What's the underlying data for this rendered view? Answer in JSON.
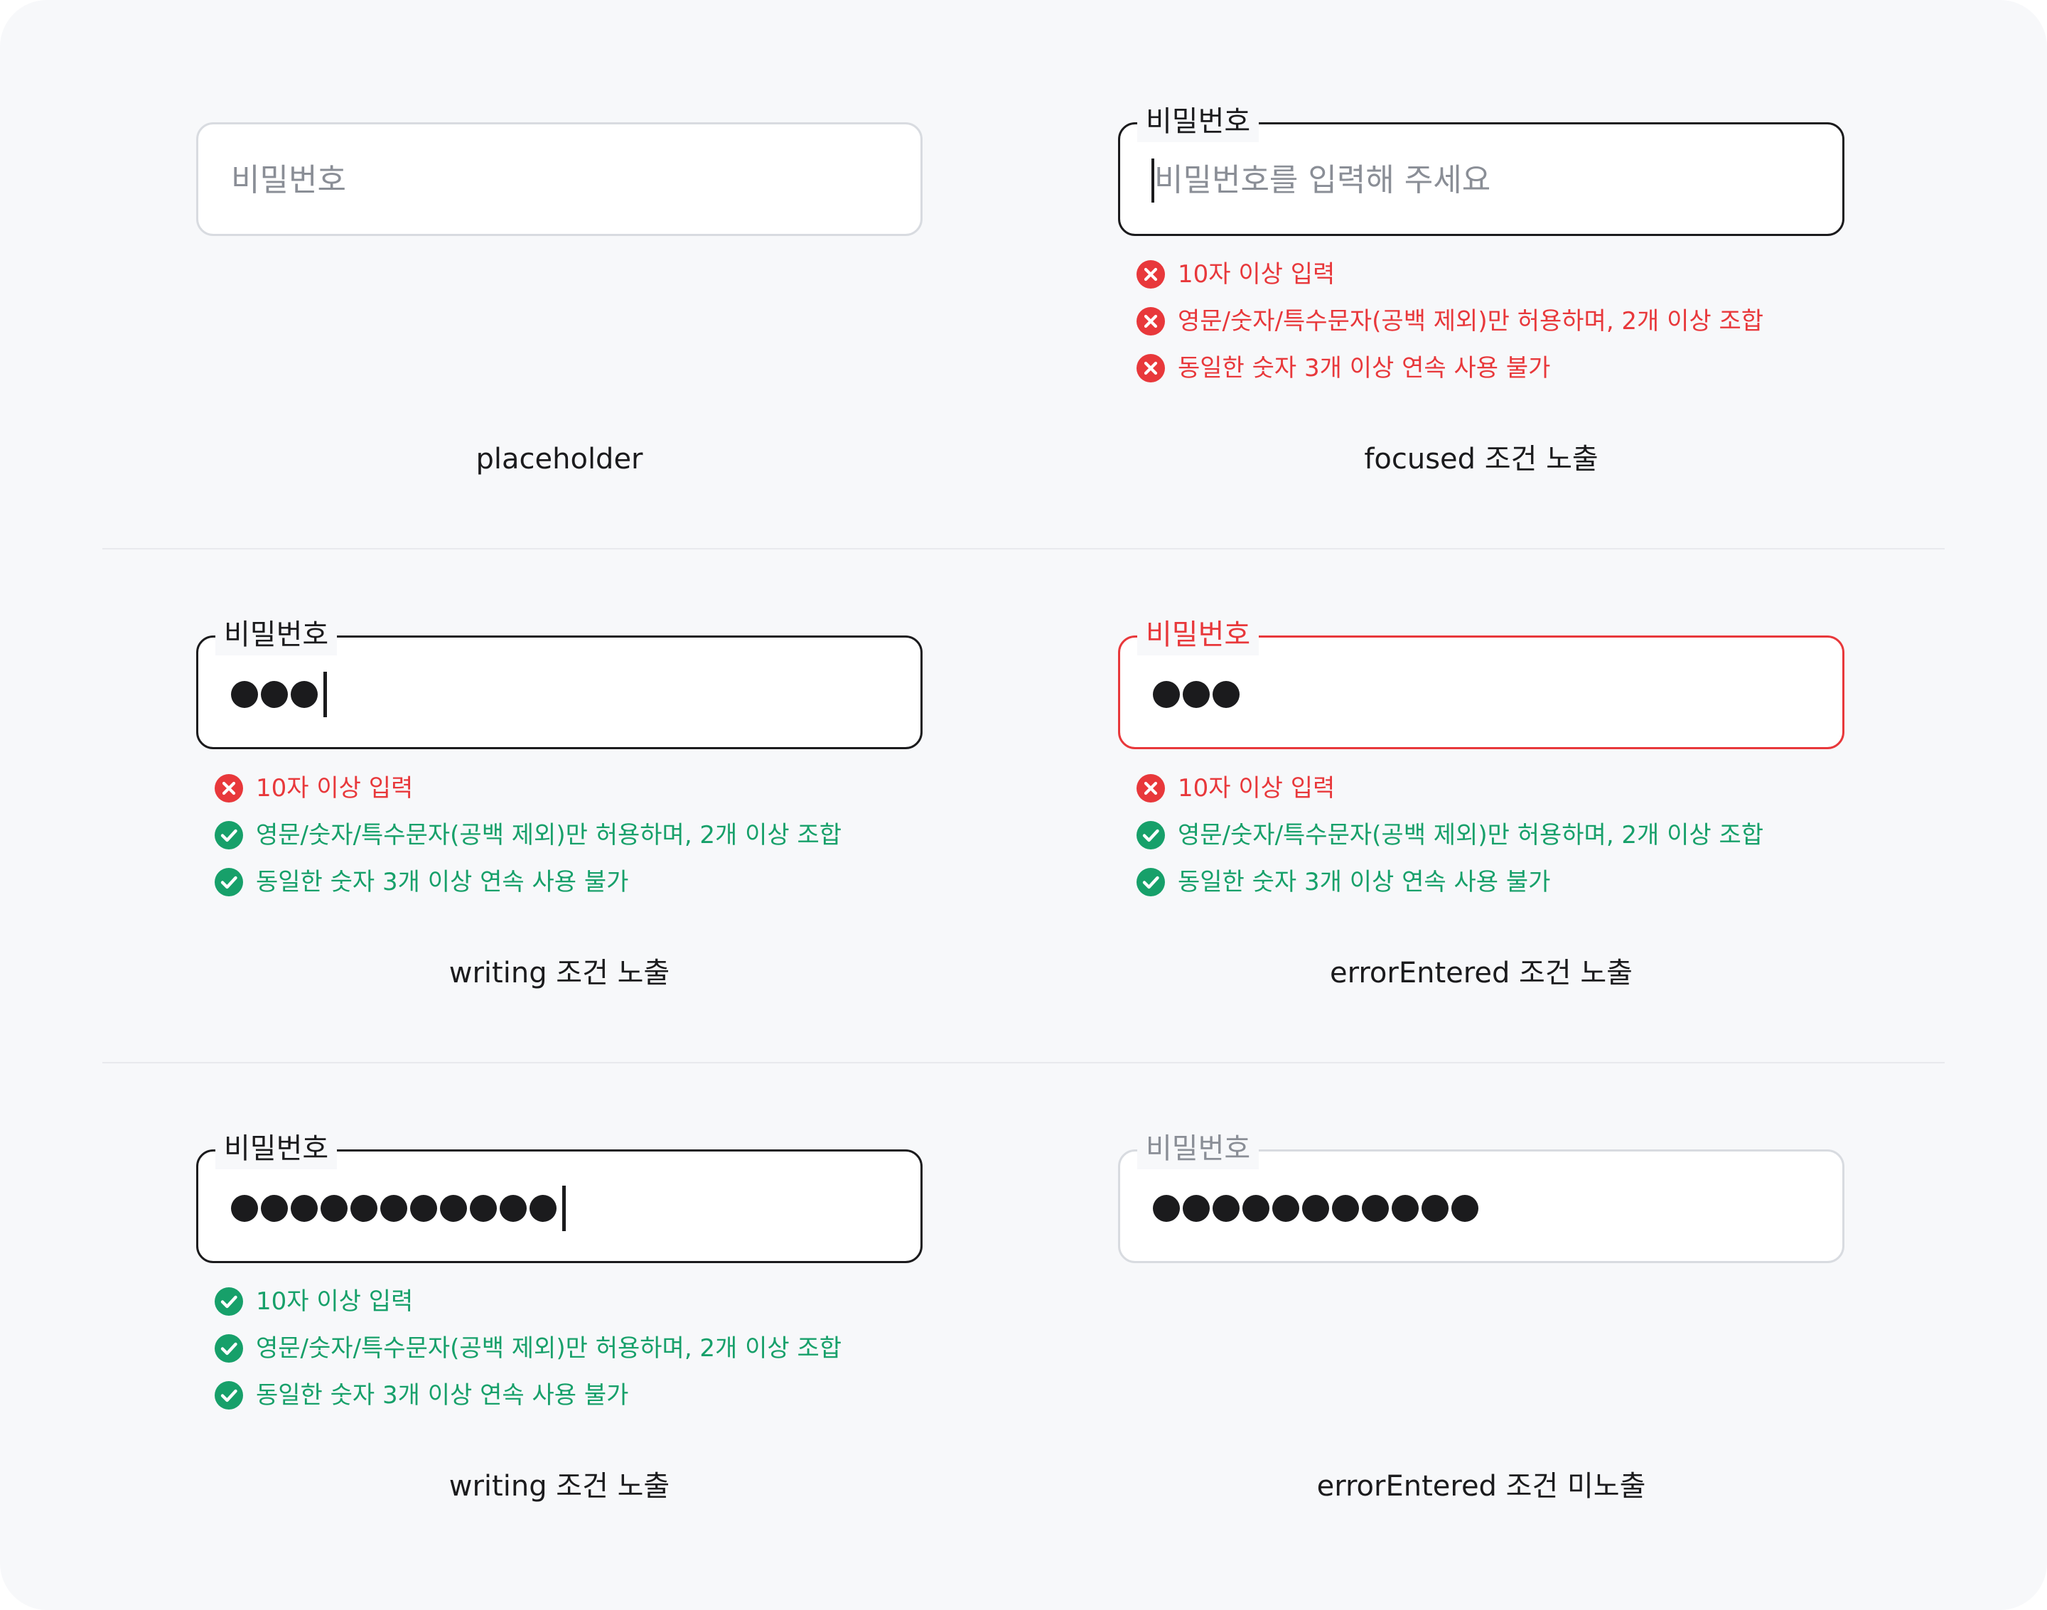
{
  "colors": {
    "error": "#e8383b",
    "success": "#17a06a",
    "text": "#1b1b1d",
    "muted": "#8a8e96",
    "border_default": "#d8dbe0"
  },
  "field_label": "비밀번호",
  "placeholder": "비밀번호",
  "focused_placeholder": "비밀번호를 입력해 주세요",
  "rules": [
    "10자 이상 입력",
    "영문/숫자/특수문자(공백 제외)만 허용하며, 2개 이상 조합",
    "동일한 숫자 3개 이상 연속 사용 불가"
  ],
  "states": [
    {
      "caption": "placeholder",
      "masked_length": 0
    },
    {
      "caption": "focused 조건 노출",
      "masked_length": 0,
      "rule_status": [
        "fail",
        "fail",
        "fail"
      ]
    },
    {
      "caption": "writing 조건 노출",
      "masked_length": 3,
      "rule_status": [
        "fail",
        "pass",
        "pass"
      ]
    },
    {
      "caption": "errorEntered 조건 노출",
      "masked_length": 3,
      "rule_status": [
        "fail",
        "pass",
        "pass"
      ]
    },
    {
      "caption": "writing 조건 노출",
      "masked_length": 11,
      "rule_status": [
        "pass",
        "pass",
        "pass"
      ]
    },
    {
      "caption": "errorEntered 조건 미노출",
      "masked_length": 11
    }
  ]
}
